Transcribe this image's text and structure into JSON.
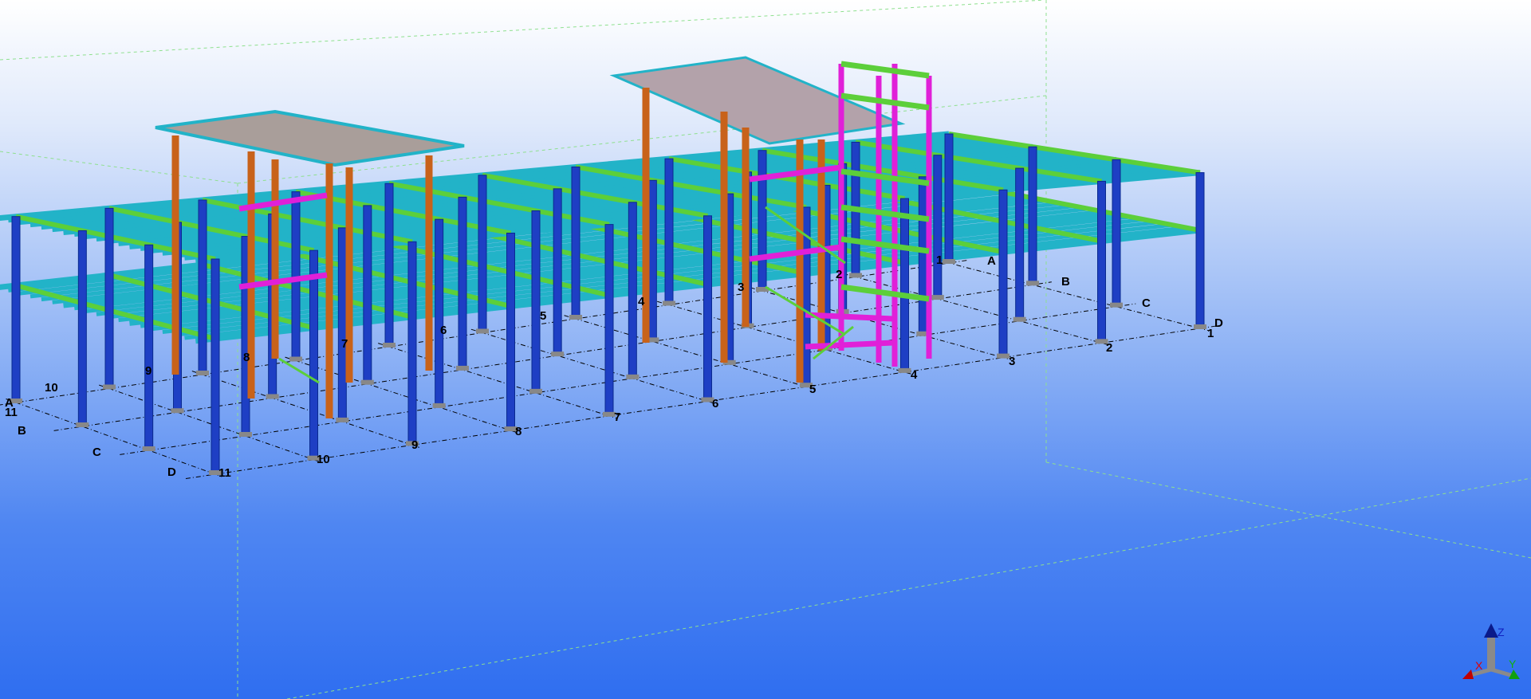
{
  "view": {
    "type": "3d-structural-model-view",
    "colors": {
      "column_primary": "#1e3fc4",
      "column_secondary": "#c8621a",
      "beam": "#22b3c8",
      "girder": "#5ccf3a",
      "bracing": "#e020d8",
      "roof_deck": "#a99e9a",
      "grid_line": "#000000",
      "work_area": "#7ee07e"
    }
  },
  "grid": {
    "front_numbers": [
      "11",
      "10",
      "9",
      "8",
      "7",
      "6",
      "5",
      "4",
      "3",
      "2",
      "1"
    ],
    "back_numbers": [
      "11",
      "10",
      "9",
      "8",
      "7",
      "6",
      "5",
      "4",
      "3",
      "2",
      "1"
    ],
    "left_letters": [
      "A",
      "B",
      "C",
      "D"
    ],
    "right_letters": [
      "A",
      "B",
      "C",
      "D"
    ]
  },
  "axes": {
    "x": "X",
    "y": "Y",
    "z": "Z"
  }
}
